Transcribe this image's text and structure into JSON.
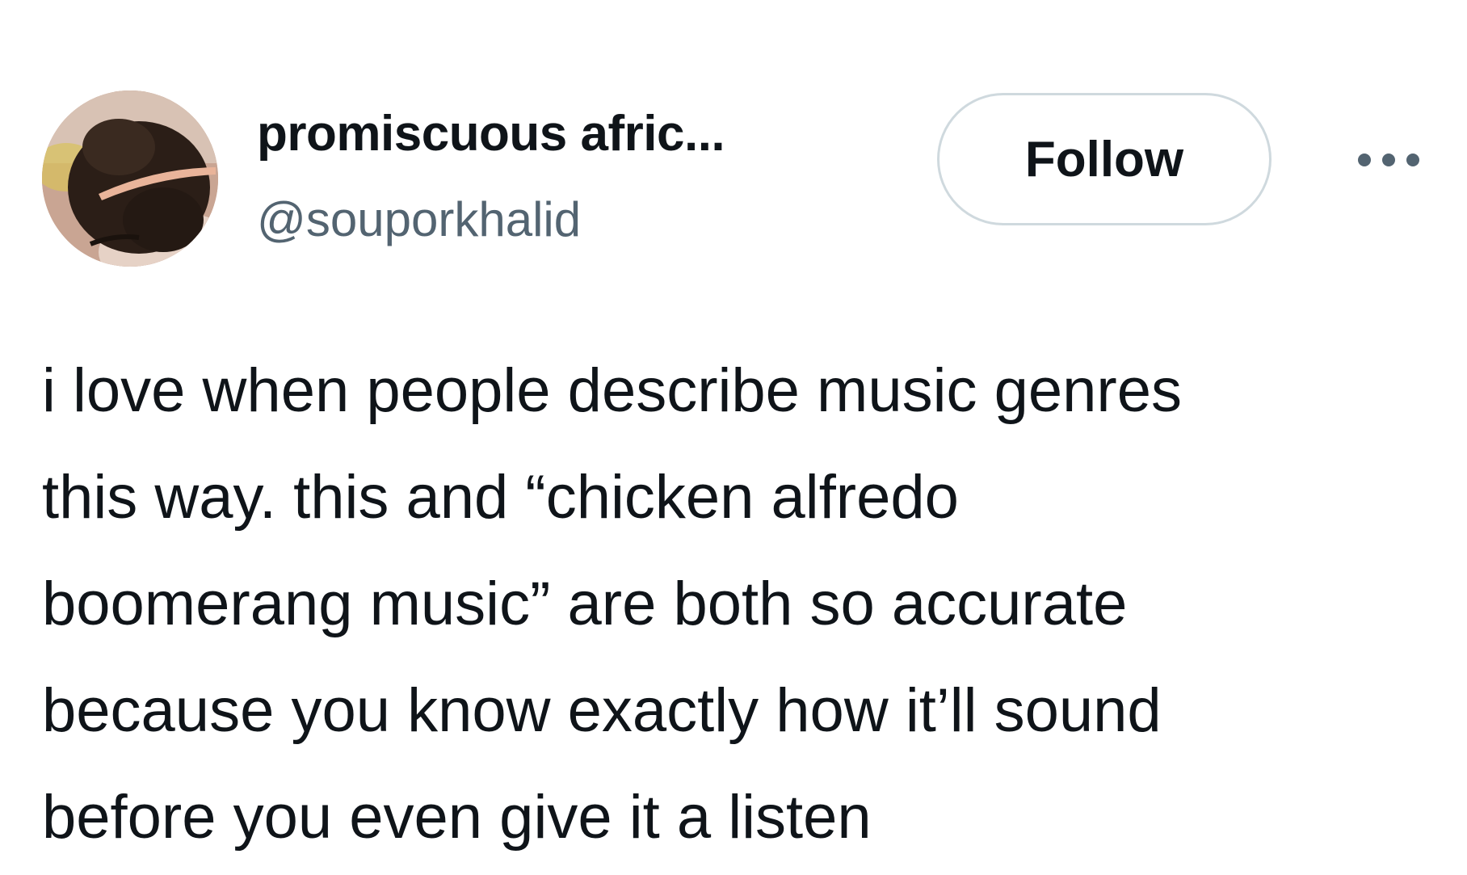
{
  "author": {
    "display_name": "promiscuous afric...",
    "handle": "@souporkhalid"
  },
  "actions": {
    "follow_label": "Follow",
    "more_icon": "more-horizontal-icon"
  },
  "tweet": {
    "lines": [
      "i love when people describe music genres",
      "this way. this and “chicken alfredo",
      "boomerang music” are both so accurate",
      "because you know exactly how it’ll sound",
      "before you even give it a listen"
    ]
  },
  "colors": {
    "text": "#0f1419",
    "secondary_text": "#536471",
    "button_border": "#cfd9de",
    "background": "#ffffff"
  }
}
